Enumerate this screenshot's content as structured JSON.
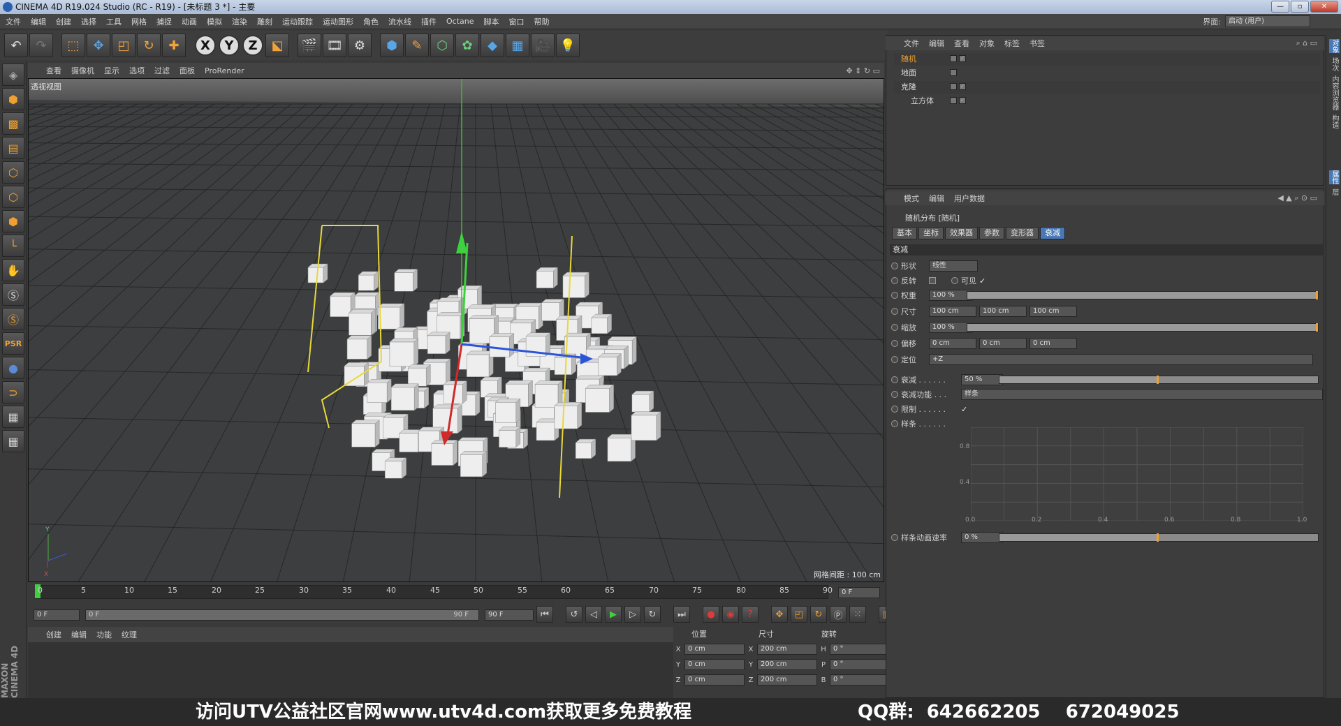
{
  "window": {
    "title": "CINEMA 4D R19.024 Studio (RC - R19) - [未标题 3 *] - 主要",
    "buttons": [
      "—",
      "▫",
      "✕"
    ]
  },
  "menubar": [
    "文件",
    "编辑",
    "创建",
    "选择",
    "工具",
    "网格",
    "捕捉",
    "动画",
    "模拟",
    "渲染",
    "雕刻",
    "运动跟踪",
    "运动图形",
    "角色",
    "流水线",
    "插件",
    "Octane",
    "脚本",
    "窗口",
    "帮助"
  ],
  "layout": {
    "label": "界面:",
    "value": "启动 (用户)"
  },
  "toolbar": {
    "axes": [
      "X",
      "Y",
      "Z"
    ]
  },
  "viewport": {
    "menu": [
      "查看",
      "摄像机",
      "显示",
      "选项",
      "过滤",
      "面板",
      "ProRender"
    ],
    "label": "透视视图",
    "grid_spacing": "网格间距 : 100 cm",
    "axes_labels": [
      "Y",
      "X"
    ]
  },
  "timeline": {
    "ticks": [
      "0",
      "5",
      "10",
      "15",
      "20",
      "25",
      "30",
      "35",
      "40",
      "45",
      "50",
      "55",
      "60",
      "65",
      "70",
      "75",
      "80",
      "85",
      "90"
    ],
    "current": "0 F",
    "start": "0 F",
    "range_start": "0 F",
    "range_end": "90 F",
    "end": "90 F"
  },
  "materials": {
    "menu": [
      "创建",
      "编辑",
      "功能",
      "纹理"
    ]
  },
  "coords": {
    "headers": [
      "位置",
      "尺寸",
      "旋转"
    ],
    "rows": [
      {
        "a1": "X",
        "v1": "0 cm",
        "a2": "X",
        "v2": "200 cm",
        "a3": "H",
        "v3": "0 °"
      },
      {
        "a1": "Y",
        "v1": "0 cm",
        "a2": "Y",
        "v2": "200 cm",
        "a3": "P",
        "v3": "0 °"
      },
      {
        "a1": "Z",
        "v1": "0 cm",
        "a2": "Z",
        "v2": "200 cm",
        "a3": "B",
        "v3": "0 °"
      }
    ]
  },
  "object_manager": {
    "menu": [
      "文件",
      "编辑",
      "查看",
      "对象",
      "标签",
      "书签"
    ],
    "objects": [
      "随机",
      "地面",
      "克隆",
      "立方体"
    ]
  },
  "attribute_manager": {
    "menu": [
      "模式",
      "编辑",
      "用户数据"
    ],
    "title": "随机分布 [随机]",
    "tabs": [
      "基本",
      "坐标",
      "效果器",
      "参数",
      "变形器",
      "衰减"
    ],
    "section": "衰减",
    "shape_label": "形状",
    "shape_value": "线性",
    "invert_label": "反转",
    "visible_label": "可见",
    "weight_label": "权重",
    "weight_value": "100 %",
    "weight_fraction": 1.0,
    "size_label": "尺寸",
    "size_values": [
      "100 cm",
      "100 cm",
      "100 cm"
    ],
    "scale_label": "缩放",
    "scale_value": "100 %",
    "scale_fraction": 1.0,
    "offset_label": "偏移",
    "offset_values": [
      "0 cm",
      "0 cm",
      "0 cm"
    ],
    "orient_label": "定位",
    "orient_value": "+Z",
    "falloff_label": "衰减 . . . . . .",
    "falloff_value": "50 %",
    "falloff_fraction": 0.5,
    "func_label": "衰减功能 . . .",
    "func_value": "样条",
    "clamp_label": "限制 . . . . . .",
    "spline_label": "样条 . . . . . .",
    "graph_y": [
      "0.8",
      "0.4"
    ],
    "graph_x": [
      "0.0",
      "0.2",
      "0.4",
      "0.6",
      "0.8",
      "1.0"
    ],
    "anim_label": "样条动画速率",
    "anim_value": "0 %",
    "anim_fraction": 0.5
  },
  "right_strip": [
    "对象",
    "场次",
    "内容浏览器",
    "构造",
    "属性",
    "层"
  ],
  "brand": "MAXON CINEMA 4D",
  "watermark": {
    "left": "访问UTV公益社区官网www.utv4d.com获取更多免费教程",
    "right": "QQ群:  642662205    672049025"
  },
  "colors": {
    "accent": "#4a78b5",
    "tool_orange": "#f0a030",
    "viewport_bg": "#2f3233"
  }
}
